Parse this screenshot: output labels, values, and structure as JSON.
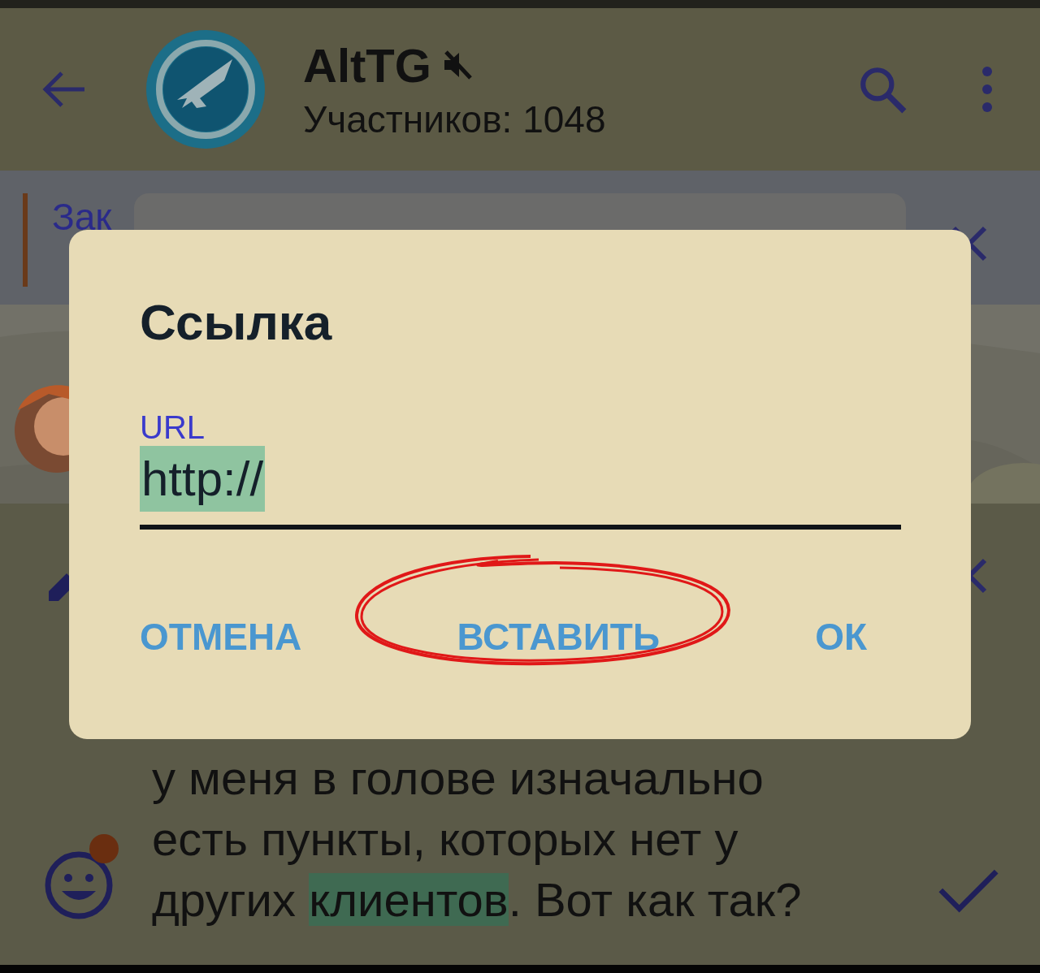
{
  "header": {
    "title": "AltTG",
    "muted": true,
    "subtitle": "Участников: 1048"
  },
  "pinned": {
    "label": "Зак"
  },
  "composer": {
    "lines": [
      [
        {
          "text": "у меня в голове изначально",
          "selected": false
        }
      ],
      [
        {
          "text": "есть пункты, которых нет у",
          "selected": false
        }
      ],
      [
        {
          "text": "других ",
          "selected": false
        },
        {
          "text": "клиентов",
          "selected": true
        },
        {
          "text": ". Вот как так?",
          "selected": false
        }
      ]
    ],
    "notification_dot": true
  },
  "dialog": {
    "title": "Ссылка",
    "field": {
      "label": "URL",
      "value": "http://",
      "selected": true
    },
    "buttons": [
      {
        "label": "ОТМЕНА",
        "circled": false
      },
      {
        "label": "ВСТАВИТЬ",
        "circled": true
      },
      {
        "label": "ОК",
        "circled": false
      }
    ]
  }
}
